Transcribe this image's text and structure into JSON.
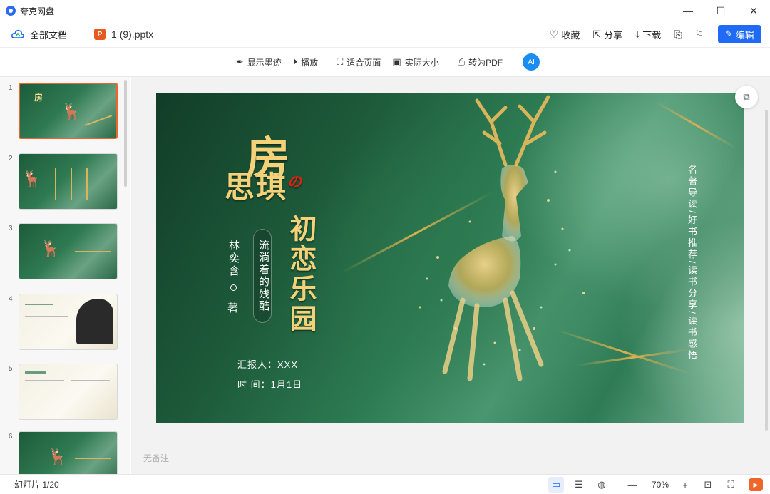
{
  "window": {
    "app_name": "夸克网盘",
    "controls": {
      "minimize": "—",
      "maximize": "☐",
      "close": "✕"
    }
  },
  "header": {
    "all_docs_label": "全部文档",
    "file_type_badge": "P",
    "file_name": "1 (9).pptx",
    "actions": {
      "favorite": "收藏",
      "share": "分享",
      "download": "下载"
    },
    "edit_label": "编辑"
  },
  "toolbar": {
    "show_ink": "显示墨迹",
    "play": "播放",
    "fit_page": "适合页面",
    "actual_size": "实际大小",
    "to_pdf": "转为PDF",
    "ai_label": "AI"
  },
  "thumbnails": {
    "numbers": [
      "1",
      "2",
      "3",
      "4",
      "5",
      "6"
    ],
    "selected_index": 1
  },
  "slide": {
    "title_top": "房",
    "title_no": "の",
    "title_mid": "思琪",
    "title_vertical": "初恋乐园",
    "subtitle": "流淌着的残酷",
    "author": "林奕含",
    "author_suffix": "著",
    "reporter": "汇报人：XXX",
    "time": "时  间：1月1日",
    "tagline": "名著导读/好书推荐/读书分享/读书感悟"
  },
  "notes_placeholder": "无备注",
  "status": {
    "slide_counter": "幻灯片 1/20",
    "zoom": "70%"
  },
  "colors": {
    "accent_blue": "#1f6bf5",
    "accent_orange": "#f0652a",
    "gold": "#f3d27a",
    "slide_green": "#1d5a3a"
  }
}
